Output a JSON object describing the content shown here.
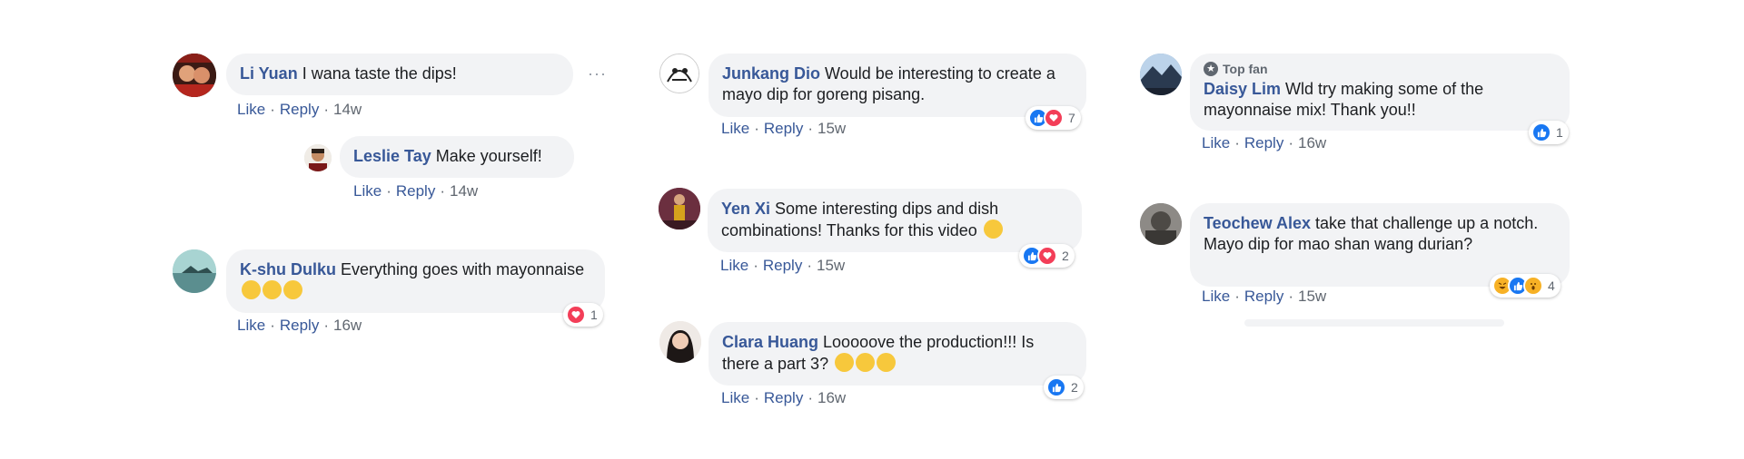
{
  "columns": [
    {
      "comments": [
        {
          "author": "Li Yuan",
          "text": "I wana taste the dips!",
          "actions": {
            "like": "Like",
            "reply": "Reply",
            "time": "14w"
          },
          "more": "···"
        },
        {
          "author": "Leslie Tay",
          "text": "Make yourself!",
          "actions": {
            "like": "Like",
            "reply": "Reply",
            "time": "14w"
          }
        },
        {
          "author": "K-shu Dulku",
          "text": "Everything goes with mayonnaise",
          "actions": {
            "like": "Like",
            "reply": "Reply",
            "time": "16w"
          },
          "reactions": {
            "types": [
              "love"
            ],
            "count": "1"
          }
        }
      ]
    },
    {
      "comments": [
        {
          "author": "Junkang Dio",
          "text": "Would be interesting to create a mayo dip for goreng pisang.",
          "actions": {
            "like": "Like",
            "reply": "Reply",
            "time": "15w"
          },
          "reactions": {
            "types": [
              "like",
              "love"
            ],
            "count": "7"
          }
        },
        {
          "author": "Yen Xi",
          "text": "Some interesting dips and dish combinations! Thanks for this video",
          "actions": {
            "like": "Like",
            "reply": "Reply",
            "time": "15w"
          },
          "reactions": {
            "types": [
              "like",
              "love"
            ],
            "count": "2"
          }
        },
        {
          "author": "Clara Huang",
          "text": "Looooove the production!!! Is there a part 3?",
          "actions": {
            "like": "Like",
            "reply": "Reply",
            "time": "16w"
          },
          "reactions": {
            "types": [
              "like"
            ],
            "count": "2"
          }
        }
      ]
    },
    {
      "comments": [
        {
          "badge": "Top fan",
          "author": "Daisy Lim",
          "text": "Wld try making some of the mayonnaise mix! Thank you!!",
          "actions": {
            "like": "Like",
            "reply": "Reply",
            "time": "16w"
          },
          "reactions": {
            "types": [
              "like"
            ],
            "count": "1"
          }
        },
        {
          "author": "Teochew Alex",
          "text": "take that challenge up a notch.",
          "text2": "Mayo dip for mao shan wang durian?",
          "actions": {
            "like": "Like",
            "reply": "Reply",
            "time": "15w"
          },
          "reactions": {
            "types": [
              "haha",
              "like",
              "wow"
            ],
            "count": "4"
          }
        }
      ]
    }
  ],
  "colors": {
    "author": "#385898",
    "bubble": "#f2f3f5",
    "meta": "#606770",
    "like": "#1877f2",
    "love": "#f33e58",
    "haha": "#f7b125"
  }
}
